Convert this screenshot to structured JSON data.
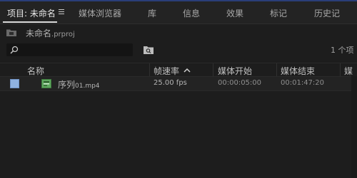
{
  "tabs": [
    {
      "label": "项目: 未命名"
    },
    {
      "label": "媒体浏览器"
    },
    {
      "label": "库"
    },
    {
      "label": "信息"
    },
    {
      "label": "效果"
    },
    {
      "label": "标记"
    },
    {
      "label": "历史记"
    }
  ],
  "project": {
    "name": "未命名",
    "ext": ".prproj"
  },
  "search": {
    "value": "",
    "placeholder": ""
  },
  "item_count": "1 个项",
  "columns": {
    "name": "名称",
    "frame_rate": "帧速率",
    "media_start": "媒体开始",
    "media_end": "媒体结束",
    "media_dur": "媒"
  },
  "rows": [
    {
      "name_main": "序列",
      "name_small": "01.mp4",
      "frame_rate": "25.00 fps",
      "media_start": "00:00:05:00",
      "media_end": "00:01:47:20",
      "label_color": "#8fb2e0"
    }
  ],
  "colors": {
    "accent_topline": "#2a3e78",
    "sequence_icon": "#5fa85f"
  },
  "icons": {
    "panel_menu": "hamburger-icon",
    "folder": "folder-icon",
    "search": "search-icon",
    "new_bin": "new-bin-icon",
    "sort": "chevron-up-icon",
    "sequence": "sequence-icon"
  }
}
